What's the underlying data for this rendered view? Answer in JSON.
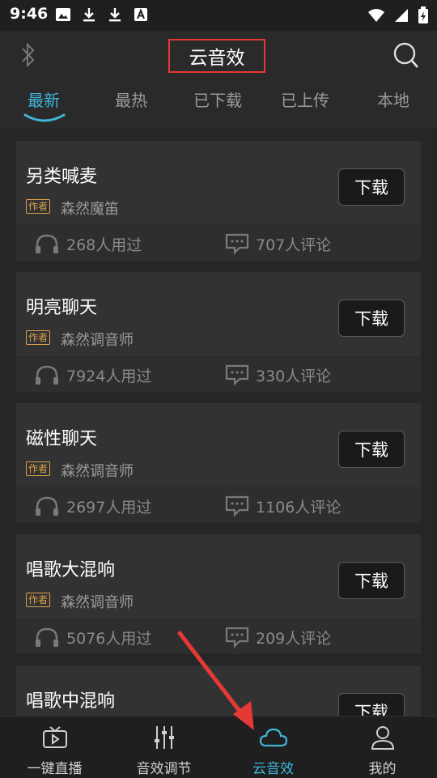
{
  "status": {
    "time": "9:46"
  },
  "header": {
    "title": "云音效"
  },
  "tabs": [
    {
      "label": "最新",
      "active": true
    },
    {
      "label": "最热"
    },
    {
      "label": "已下载"
    },
    {
      "label": "已上传"
    },
    {
      "label": "本地"
    }
  ],
  "items": [
    {
      "name": "另类喊麦",
      "badge": "作者",
      "author": "森然魔笛",
      "button": "下载",
      "uses": "268人用过",
      "comments": "707人评论"
    },
    {
      "name": "明亮聊天",
      "badge": "作者",
      "author": "森然调音师",
      "button": "下载",
      "uses": "7924人用过",
      "comments": "330人评论"
    },
    {
      "name": "磁性聊天",
      "badge": "作者",
      "author": "森然调音师",
      "button": "下载",
      "uses": "2697人用过",
      "comments": "1106人评论"
    },
    {
      "name": "唱歌大混响",
      "badge": "作者",
      "author": "森然调音师",
      "button": "下载",
      "uses": "5076人用过",
      "comments": "209人评论"
    },
    {
      "name": "唱歌中混响",
      "badge": "",
      "author": "",
      "button": "下载",
      "uses": "",
      "comments": ""
    }
  ],
  "bottom_nav": [
    {
      "label": "一键直播",
      "icon": "tv-play-icon"
    },
    {
      "label": "音效调节",
      "icon": "equalizer-icon"
    },
    {
      "label": "云音效",
      "icon": "cloud-icon",
      "active": true
    },
    {
      "label": "我的",
      "icon": "person-icon"
    }
  ],
  "colors": {
    "accent": "#3fb6d8",
    "highlight_box": "#e53935",
    "badge": "#d9a14a",
    "arrow": "#e53935"
  }
}
